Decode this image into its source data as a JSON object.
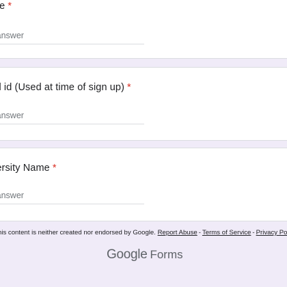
{
  "questions": [
    {
      "title": "me",
      "required_mark": "*",
      "placeholder": "r answer"
    },
    {
      "title": "ail id (Used at time of sign up)",
      "required_mark": "*",
      "placeholder": "r answer"
    },
    {
      "title": "versity Name",
      "required_mark": "*",
      "placeholder": "r answer"
    }
  ],
  "footer": {
    "disclaimer": "his content is neither created nor endorsed by Google.",
    "report_abuse": "Report Abuse",
    "terms": "Terms of Service",
    "privacy": "Privacy Polic",
    "separator": "-"
  },
  "logo": {
    "google": "Google",
    "forms": "Forms"
  },
  "colors": {
    "background": "#f0ebf8",
    "required": "#d93025",
    "card": "#ffffff"
  }
}
